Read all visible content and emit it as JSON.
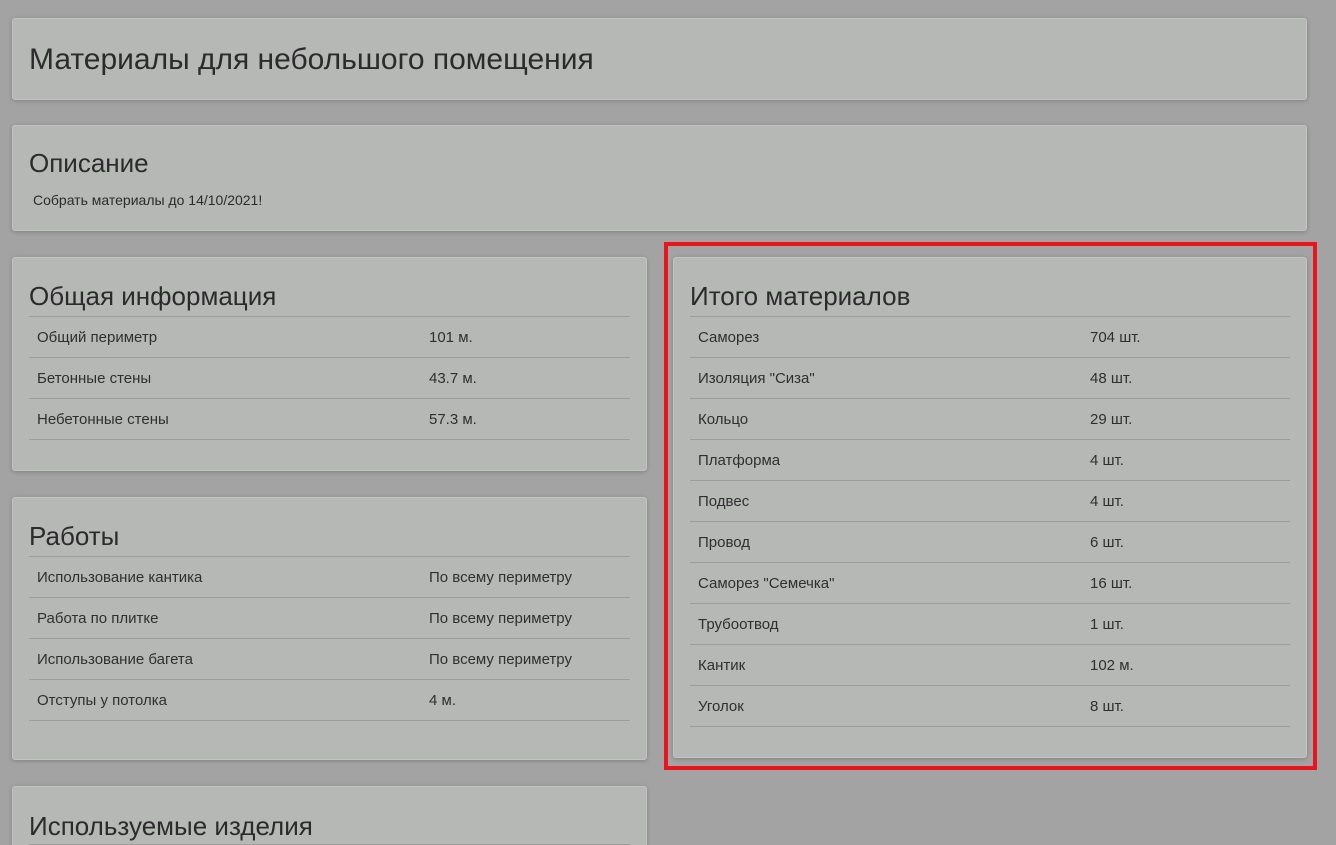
{
  "page": {
    "title": "Материалы для небольшого помещения"
  },
  "description": {
    "heading": "Описание",
    "text": "Собрать материалы до 14/10/2021!"
  },
  "general_info": {
    "heading": "Общая информация",
    "rows": [
      {
        "key": "Общий периметр",
        "value": "101 м."
      },
      {
        "key": "Бетонные стены",
        "value": "43.7 м."
      },
      {
        "key": "Небетонные стены",
        "value": "57.3 м."
      }
    ]
  },
  "works": {
    "heading": "Работы",
    "rows": [
      {
        "key": "Использование кантика",
        "value": "По всему периметру"
      },
      {
        "key": "Работа по плитке",
        "value": "По всему периметру"
      },
      {
        "key": "Использование багета",
        "value": "По всему периметру"
      },
      {
        "key": "Отступы у потолка",
        "value": "4 м."
      }
    ]
  },
  "products": {
    "heading": "Используемые изделия"
  },
  "materials_total": {
    "heading": "Итого материалов",
    "rows": [
      {
        "key": "Саморез",
        "value": "704 шт."
      },
      {
        "key": "Изоляция \"Сиза\"",
        "value": "48 шт."
      },
      {
        "key": "Кольцо",
        "value": "29 шт."
      },
      {
        "key": "Платформа",
        "value": "4 шт."
      },
      {
        "key": "Подвес",
        "value": "4 шт."
      },
      {
        "key": "Провод",
        "value": "6 шт."
      },
      {
        "key": "Саморез \"Семечка\"",
        "value": "16 шт."
      },
      {
        "key": "Трубоотвод",
        "value": "1 шт."
      },
      {
        "key": "Кантик",
        "value": "102 м."
      },
      {
        "key": "Уголок",
        "value": "8 шт."
      }
    ]
  },
  "colors": {
    "background": "#a3a3a3",
    "card": "#b6b8b6",
    "highlight": "#e8141e"
  }
}
